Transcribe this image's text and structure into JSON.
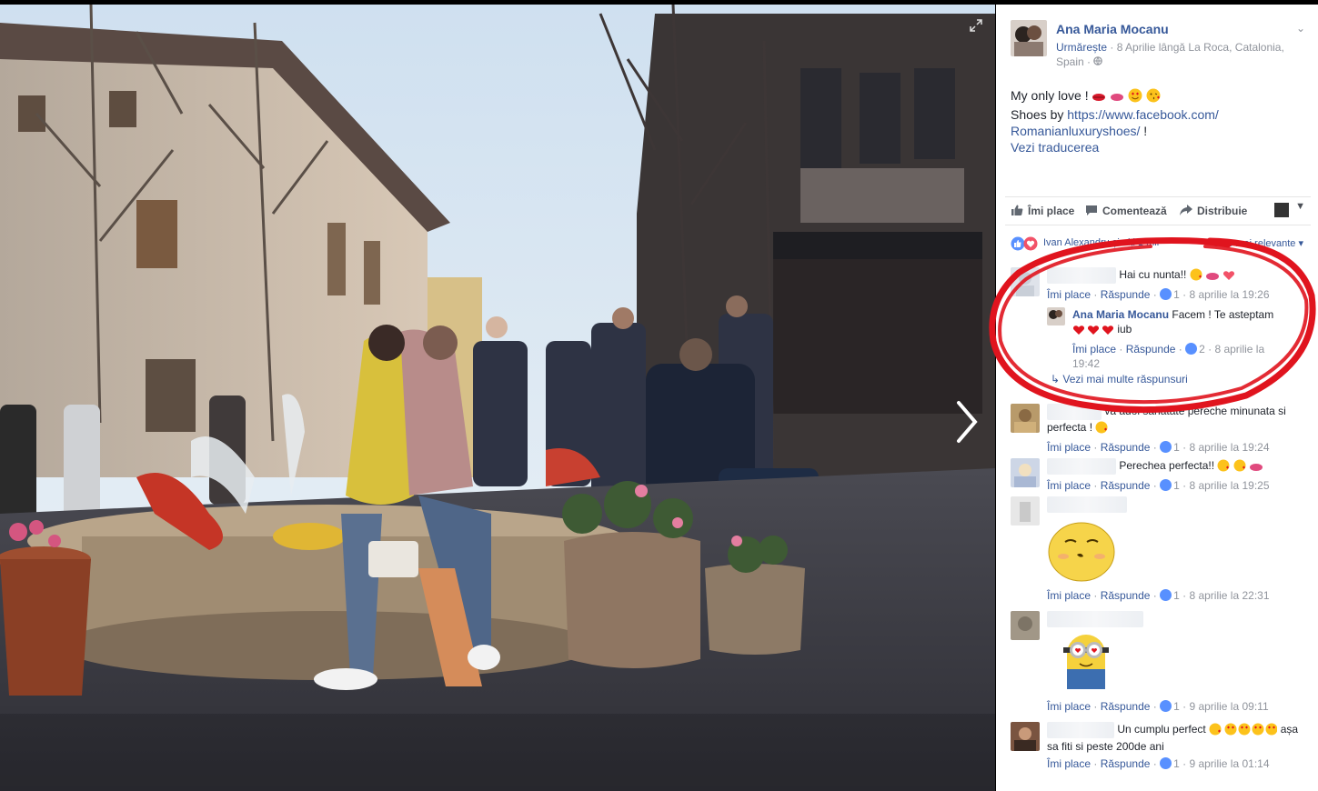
{
  "post": {
    "author": "Ana Maria Mocanu",
    "follow_label": "Urmărește",
    "meta_text": "8 Aprilie lângă La Roca, Catalonia, Spain",
    "text_line1": "My only love ! ",
    "text_line2_prefix": "Shoes by ",
    "link_part1": "https://www.facebook.com/",
    "link_part2": "Romanianluxuryshoes/",
    "link_suffix": " !",
    "see_translation": "Vezi traducerea"
  },
  "actions": {
    "like": "Îmi place",
    "comment": "Comentează",
    "share": "Distribuie"
  },
  "reactions": {
    "text": "Ivan Alexandru și alți 1 mii",
    "sort": "Cele mai relevante"
  },
  "comments": [
    {
      "text": "Hai cu nunta!!",
      "like": "Îmi place",
      "reply": "Răspunde",
      "count": "1",
      "time": "8 aprilie la 19:26"
    },
    {
      "author": "Ana Maria Mocanu",
      "text": "Facem ! Te asteptam",
      "text2": "iub",
      "like": "Îmi place",
      "reply": "Răspunde",
      "count": "2",
      "time": "8 aprilie la",
      "time2": "19:42"
    },
    {
      "more": "Vezi mai multe răspunsuri"
    },
    {
      "text": "va adoi sanatate pereche minunata si",
      "text2": "perfecta ! ",
      "like": "Îmi place",
      "reply": "Răspunde",
      "count": "1",
      "time": "8 aprilie la 19:24"
    },
    {
      "text": "Perechea perfecta!!",
      "like": "Îmi place",
      "reply": "Răspunde",
      "count": "1",
      "time": "8 aprilie la 19:25"
    },
    {
      "like": "Îmi place",
      "reply": "Răspunde",
      "count": "1",
      "time": "8 aprilie la 22:31"
    },
    {
      "like": "Îmi place",
      "reply": "Răspunde",
      "count": "1",
      "time": "9 aprilie la 09:11"
    },
    {
      "text": "Un cumplu perfect ",
      "text_end": "așa",
      "text2": "sa fiti si peste 200de ani",
      "like": "Îmi place",
      "reply": "Răspunde",
      "count": "1",
      "time": "9 aprilie la 01:14"
    }
  ],
  "colors": {
    "link": "#365899",
    "accent_red": "#e0141e",
    "like_blue": "#5890ff"
  },
  "icons": [
    "expand-icon",
    "next-arrow-icon",
    "like-icon",
    "comment-icon",
    "share-icon",
    "globe-icon",
    "chevron-down-icon"
  ]
}
